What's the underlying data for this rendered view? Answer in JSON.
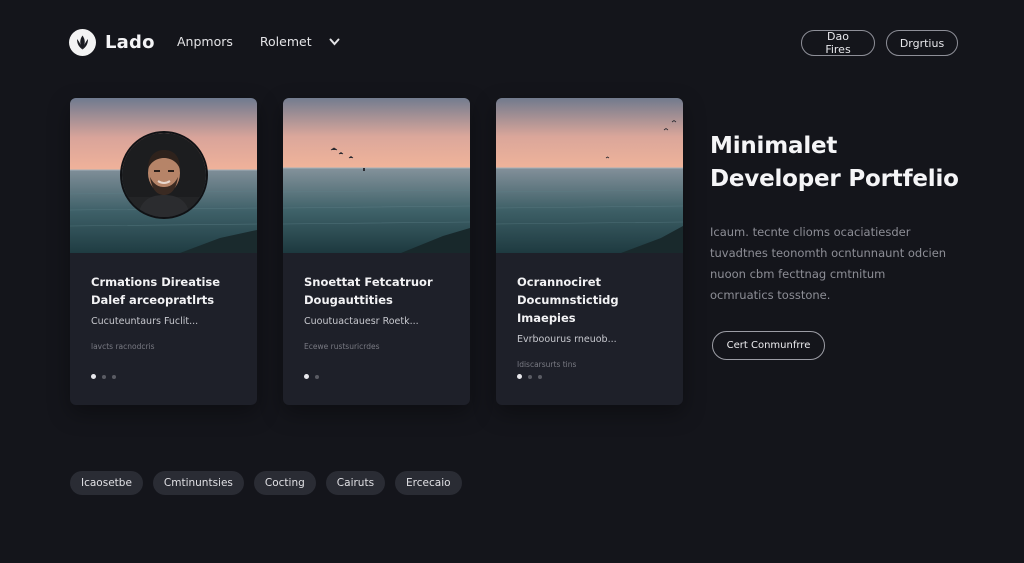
{
  "brand": {
    "name": "Lado",
    "logo_icon": "leaf-icon"
  },
  "nav": {
    "items": [
      "Anpmors",
      "Rolemet"
    ],
    "more_icon": "chevron-down-icon"
  },
  "header_actions": {
    "demo_label": "Dao Fires",
    "contact_label": "Drgrtius"
  },
  "cards": [
    {
      "title_line1": "Crmations Direatise",
      "title_line2": "Dalef arceopratlrts",
      "description": "Cucuteuntaurs Fuclit...",
      "meta": "lavcts racnodcris",
      "has_avatar": true
    },
    {
      "title_line1": "Snoettat Fetcatruor",
      "title_line2": "Dougauttities",
      "description": "Cuoutuactauesr Roetk...",
      "meta": "Ecewe rustsuricrdes",
      "has_avatar": false
    },
    {
      "title_line1": "Ocrannociret",
      "title_line2": "Documnstictidg Imaepies",
      "description": "Evrboourus rneuob...",
      "meta": "Idiscarsurts tins",
      "has_avatar": false
    }
  ],
  "hero": {
    "title_line1": "Minimalet",
    "title_line2": "Developer Portfelio",
    "paragraph": "Icaum. tecnte clioms ocaciatiesder tuvadtnes teonomth ocntunnaunt odcien nuoon cbm fecttnag cmtnitum ocmruatics tosstone.",
    "cta_label": "Cert Conmunfrre"
  },
  "tags": [
    "Icaosetbe",
    "Cmtinuntsies",
    "Cocting",
    "Cairuts",
    "Ercecaio"
  ],
  "colors": {
    "background": "#14151b",
    "card": "#1e2029",
    "tag": "#2a2c34",
    "sky_top": "#f0b29a",
    "sea": "#2c5257"
  }
}
